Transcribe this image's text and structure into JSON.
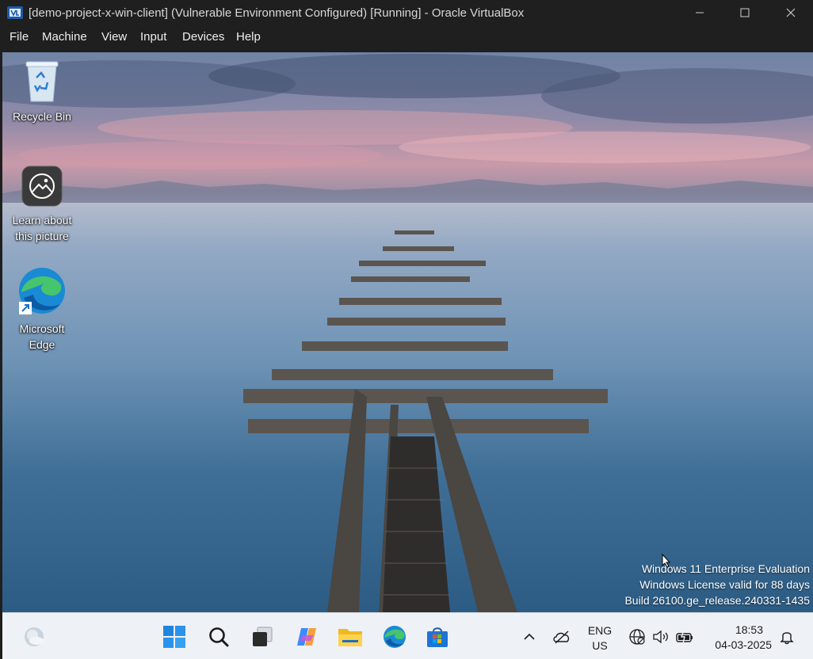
{
  "window": {
    "title": "[demo-project-x-win-client] (Vulnerable Environment Configured) [Running] - Oracle VirtualBox",
    "icon": "virtualbox-icon"
  },
  "menu": {
    "items": [
      "File",
      "Machine",
      "View",
      "Input",
      "Devices",
      "Help"
    ]
  },
  "desktop": {
    "icons": [
      {
        "label": "Recycle Bin",
        "icon": "recycle-bin-icon"
      },
      {
        "label": "Learn about this picture",
        "icon": "learn-about-picture-icon"
      },
      {
        "label": "Microsoft Edge",
        "icon": "edge-icon"
      }
    ],
    "watermark": {
      "line1": "Windows 11 Enterprise Evaluation",
      "line2": "Windows License valid for 88 days",
      "line3": "Build 26100.ge_release.240331-1435"
    }
  },
  "taskbar": {
    "apps": [
      "weather-icon",
      "start-icon",
      "search-icon",
      "task-view-icon",
      "copilot-icon",
      "file-explorer-icon",
      "edge-icon",
      "store-icon"
    ],
    "tray": {
      "lang1": "ENG",
      "lang2": "US",
      "time": "18:53",
      "date": "04-03-2025"
    }
  },
  "colors": {
    "titlebar": "#1f1f1f",
    "taskbar": "#eef1f6",
    "accent": "#0078d4"
  }
}
